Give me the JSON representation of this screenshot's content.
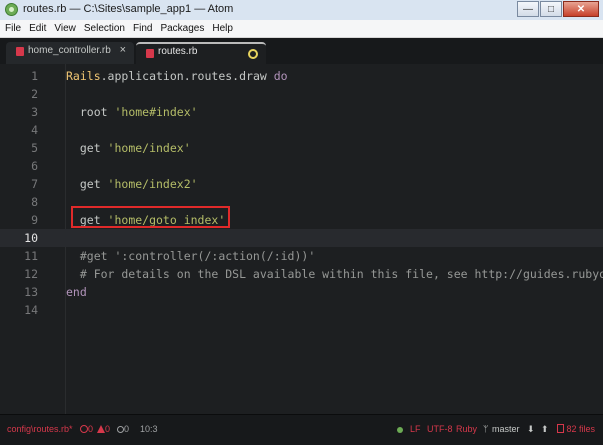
{
  "window": {
    "title": "routes.rb — C:\\Sites\\sample_app1 — Atom",
    "buttons": {
      "minimize": "—",
      "maximize": "□",
      "close": "✕"
    }
  },
  "menu": [
    "File",
    "Edit",
    "View",
    "Selection",
    "Find",
    "Packages",
    "Help"
  ],
  "tabs": [
    {
      "label": "home_controller.rb",
      "close": "×",
      "active": false
    },
    {
      "label": "routes.rb",
      "active": true,
      "modified": true
    }
  ],
  "editor": {
    "active_line": 10,
    "highlighted_line": 9,
    "lines": [
      {
        "n": "1",
        "parts": [
          [
            "k",
            "Rails"
          ],
          [
            "txt",
            ".application.routes.draw "
          ],
          [
            "kw",
            "do"
          ]
        ]
      },
      {
        "n": "2",
        "parts": []
      },
      {
        "n": "3",
        "parts": [
          [
            "txt",
            "  root "
          ],
          [
            "s",
            "'home#index'"
          ]
        ]
      },
      {
        "n": "4",
        "parts": []
      },
      {
        "n": "5",
        "parts": [
          [
            "txt",
            "  get "
          ],
          [
            "s",
            "'home/index'"
          ]
        ]
      },
      {
        "n": "6",
        "parts": []
      },
      {
        "n": "7",
        "parts": [
          [
            "txt",
            "  get "
          ],
          [
            "s",
            "'home/index2'"
          ]
        ]
      },
      {
        "n": "8",
        "parts": []
      },
      {
        "n": "9",
        "parts": [
          [
            "txt",
            "  get "
          ],
          [
            "s",
            "'home/goto_index'"
          ]
        ]
      },
      {
        "n": "10",
        "parts": []
      },
      {
        "n": "11",
        "parts": [
          [
            "c",
            "  #get ':controller(/:action(/:id))'"
          ]
        ]
      },
      {
        "n": "12",
        "parts": [
          [
            "c",
            "  # For details on the DSL available within this file, see http://guides.rubyonra"
          ]
        ]
      },
      {
        "n": "13",
        "parts": [
          [
            "kw",
            "end"
          ]
        ]
      },
      {
        "n": "14",
        "parts": []
      }
    ]
  },
  "status": {
    "file": "config\\routes.rb*",
    "errors": "0",
    "warnings": "0",
    "infos": "0",
    "cursor": "10:3",
    "line_ending": "LF",
    "encoding": "UTF-8",
    "grammar": "Ruby",
    "branch": "master",
    "push_arrow": "⬇",
    "pull_arrow": "⬆",
    "files": "82 files"
  },
  "colors": {
    "accent": "#d6384b",
    "string": "#b5bd68",
    "keyword": "#b294bb",
    "constant": "#f0c674",
    "comment": "#969896"
  }
}
